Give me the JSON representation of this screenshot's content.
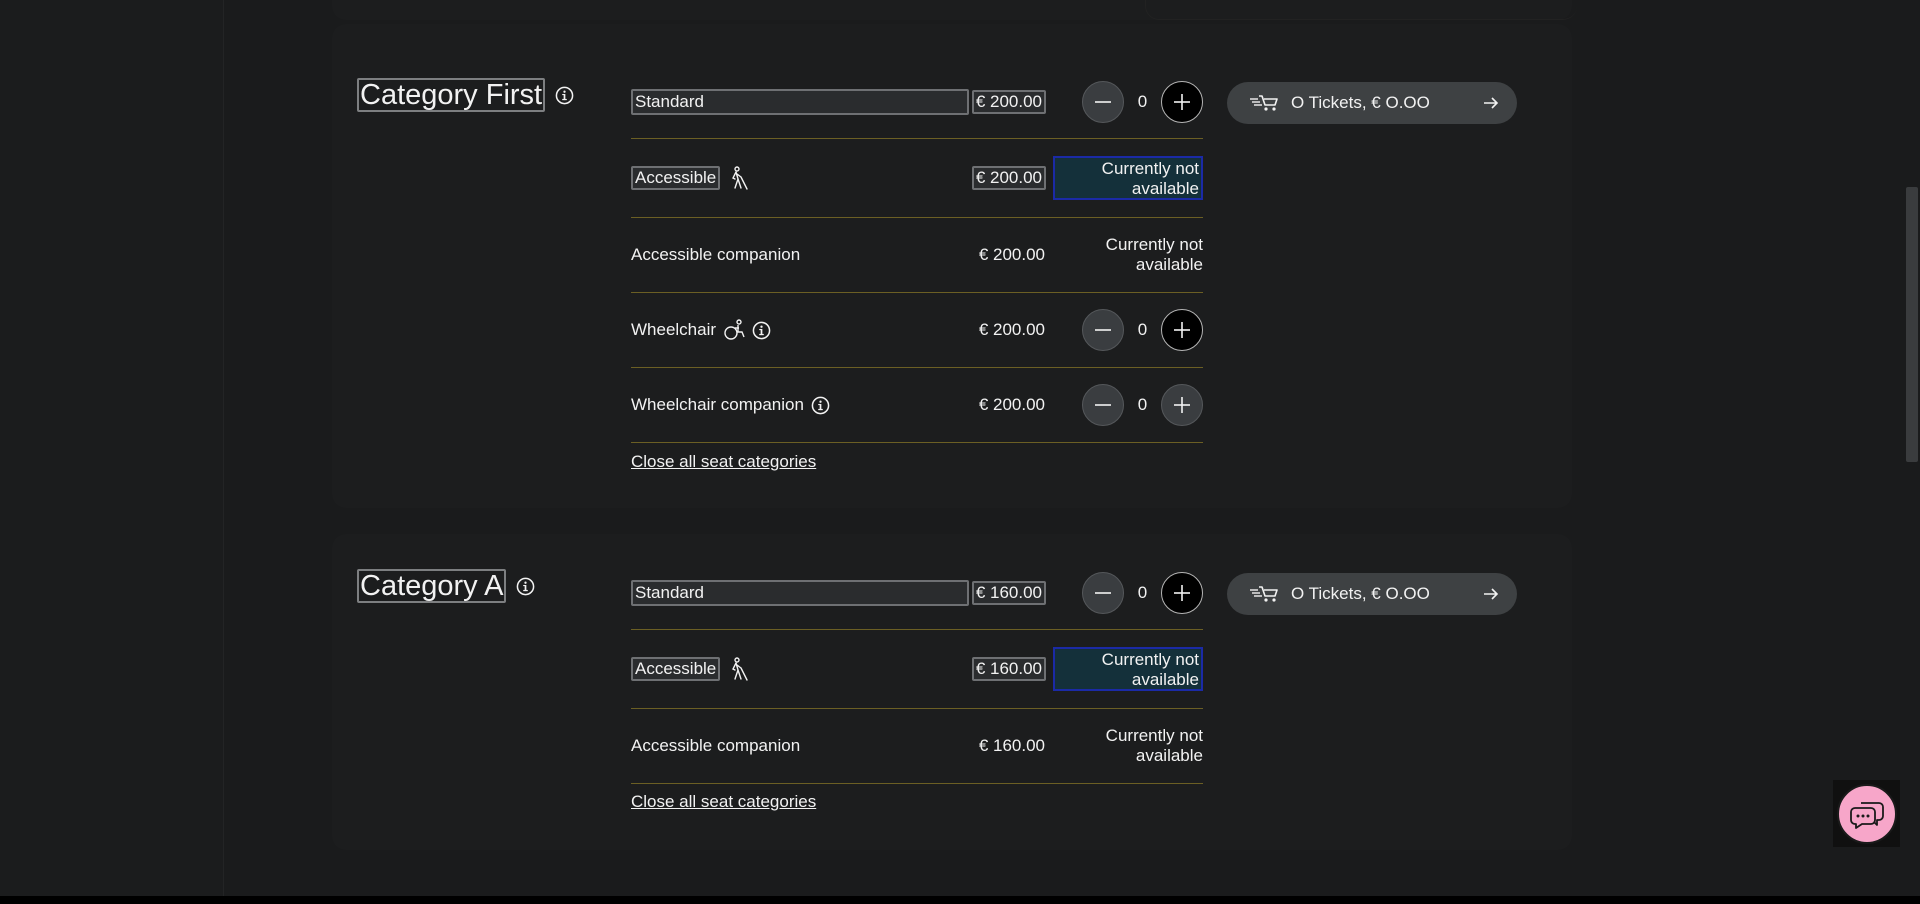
{
  "categories": [
    {
      "title": "Category First",
      "rows": [
        {
          "label": "Standard",
          "price": "€ 200.00",
          "count": "0"
        },
        {
          "label": "Accessible",
          "price": "€ 200.00",
          "status": "Currently not available"
        },
        {
          "label": "Accessible companion",
          "price": "€ 200.00",
          "status": "Currently not available"
        },
        {
          "label": "Wheelchair",
          "price": "€ 200.00",
          "count": "0"
        },
        {
          "label": "Wheelchair companion",
          "price": "€ 200.00",
          "count": "0"
        }
      ],
      "close_link": "Close all seat categories",
      "cart_label": "O Tickets, € O.OO"
    },
    {
      "title": "Category A",
      "rows": [
        {
          "label": "Standard",
          "price": "€ 160.00",
          "count": "0"
        },
        {
          "label": "Accessible",
          "price": "€ 160.00",
          "status": "Currently not available"
        },
        {
          "label": "Accessible companion",
          "price": "€ 160.00",
          "status": "Currently not available"
        }
      ],
      "close_link": "Close all seat categories",
      "cart_label": "O Tickets, € O.OO"
    }
  ],
  "icons": {
    "info": "info-icon",
    "accessible": "blind-person-icon",
    "wheelchair": "wheelchair-icon",
    "cart": "fast-cart-icon",
    "arrow": "arrow-right-icon",
    "chat": "chat-bubble-icon",
    "minus": "minus-icon",
    "plus": "plus-icon"
  },
  "colors": {
    "background": "#1a1b1c",
    "card": "#1c1d1e",
    "divider": "#6b5f24",
    "cart_button": "#3e4143",
    "chat_button": "#f7a6c9",
    "focus_border": "#1b2aa6"
  }
}
